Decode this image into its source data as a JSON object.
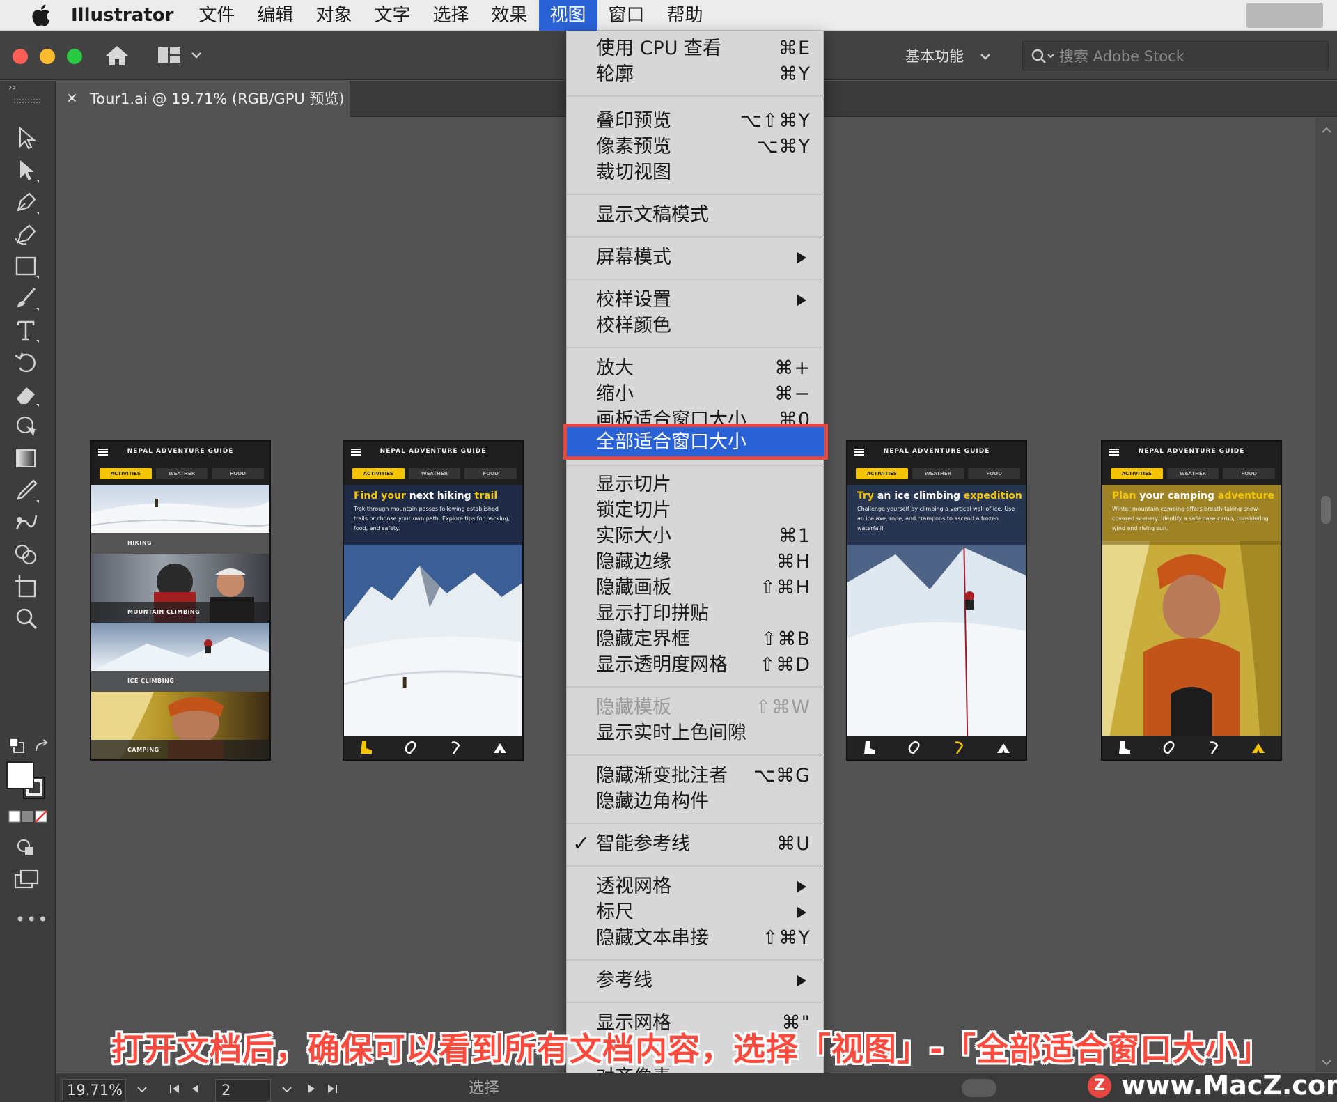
{
  "menubar": {
    "app_name": "Illustrator",
    "items": [
      "文件",
      "编辑",
      "对象",
      "文字",
      "选择",
      "效果",
      "视图",
      "窗口",
      "帮助"
    ],
    "active_item": "视图"
  },
  "toolbar": {
    "workspace": "基本功能",
    "stock_placeholder": "搜索 Adobe Stock"
  },
  "document_tab": {
    "close": "×",
    "name": "Tour1.ai @ 19.71% (RGB/GPU 预览)"
  },
  "artboards": {
    "title": "NEPAL ADVENTURE GUIDE",
    "tabs": [
      "ACTIVITIES",
      "WEATHER",
      "FOOD"
    ],
    "list_labels": [
      "HIKING",
      "MOUNTAIN CLIMBING",
      "ICE CLIMBING",
      "CAMPING"
    ],
    "hiking": {
      "heading_a": "Find your ",
      "heading_b": "next",
      "heading_c": " hiking ",
      "heading_d": "trail",
      "body": "Trek through mountain passes following established trails or choose your own path. Explore tips for packing, food, and safety."
    },
    "ice": {
      "heading_a": "Try ",
      "heading_b": "an",
      "heading_c": " ice climbing ",
      "heading_d": "expedition",
      "body": "Challenge yourself by climbing a vertical wall of ice. Use an ice axe, rope, and crampons to ascend a frozen waterfall!"
    },
    "camping": {
      "heading_a": "Plan ",
      "heading_b": "your",
      "heading_c": " camping ",
      "heading_d": "adventure",
      "body": "Winter mountain camping offers breath-taking snow-covered scenery. Identify a safe base camp, considering wind and rising sun."
    }
  },
  "view_menu": {
    "items": [
      {
        "label": "使用 CPU 查看",
        "shortcut": "⌘E"
      },
      {
        "label": "轮廓",
        "shortcut": "⌘Y"
      },
      {
        "label": "叠印预览",
        "shortcut": "⌥⇧⌘Y"
      },
      {
        "label": "像素预览",
        "shortcut": "⌥⌘Y"
      },
      {
        "label": "裁切视图",
        "shortcut": ""
      },
      {
        "label": "显示文稿模式",
        "shortcut": ""
      },
      {
        "label": "屏幕模式",
        "shortcut": ""
      },
      {
        "label": "校样设置",
        "shortcut": ""
      },
      {
        "label": "校样颜色",
        "shortcut": ""
      },
      {
        "label": "放大",
        "shortcut": "⌘+"
      },
      {
        "label": "缩小",
        "shortcut": "⌘−"
      },
      {
        "label": "画板适合窗口大小",
        "shortcut": "⌘0"
      },
      {
        "label": "全部适合窗口大小",
        "shortcut": ""
      },
      {
        "label": "显示切片",
        "shortcut": ""
      },
      {
        "label": "锁定切片",
        "shortcut": ""
      },
      {
        "label": "实际大小",
        "shortcut": "⌘1"
      },
      {
        "label": "隐藏边缘",
        "shortcut": "⌘H"
      },
      {
        "label": "隐藏画板",
        "shortcut": "⇧⌘H"
      },
      {
        "label": "显示打印拼贴",
        "shortcut": ""
      },
      {
        "label": "隐藏定界框",
        "shortcut": "⇧⌘B"
      },
      {
        "label": "显示透明度网格",
        "shortcut": "⇧⌘D"
      },
      {
        "label": "隐藏模板",
        "shortcut": "⇧⌘W"
      },
      {
        "label": "显示实时上色间隙",
        "shortcut": ""
      },
      {
        "label": "隐藏渐变批注者",
        "shortcut": "⌥⌘G"
      },
      {
        "label": "隐藏边角构件",
        "shortcut": ""
      },
      {
        "label": "智能参考线",
        "shortcut": "⌘U"
      },
      {
        "label": "透视网格",
        "shortcut": ""
      },
      {
        "label": "标尺",
        "shortcut": ""
      },
      {
        "label": "隐藏文本串接",
        "shortcut": "⇧⌘Y"
      },
      {
        "label": "参考线",
        "shortcut": ""
      },
      {
        "label": "显示网格",
        "shortcut": "⌘\""
      },
      {
        "label": "对齐像素",
        "shortcut": ""
      }
    ],
    "highlighted": "全部适合窗口大小",
    "checked": "智能参考线",
    "disabled": "隐藏模板",
    "checkmark": "✓"
  },
  "statusbar": {
    "zoom": "19.71%",
    "page": "2",
    "current_tool": "选择"
  },
  "caption": "打开文档后，确保可以看到所有文档内容，选择「视图」-「全部适合窗口大小」",
  "watermark": {
    "logo_letter": "Z",
    "text": "www.MacZ.com"
  },
  "colors": {
    "menu_highlight": "#2a62d6",
    "callout_red": "#e8473f",
    "accent_yellow": "#f4c400"
  }
}
